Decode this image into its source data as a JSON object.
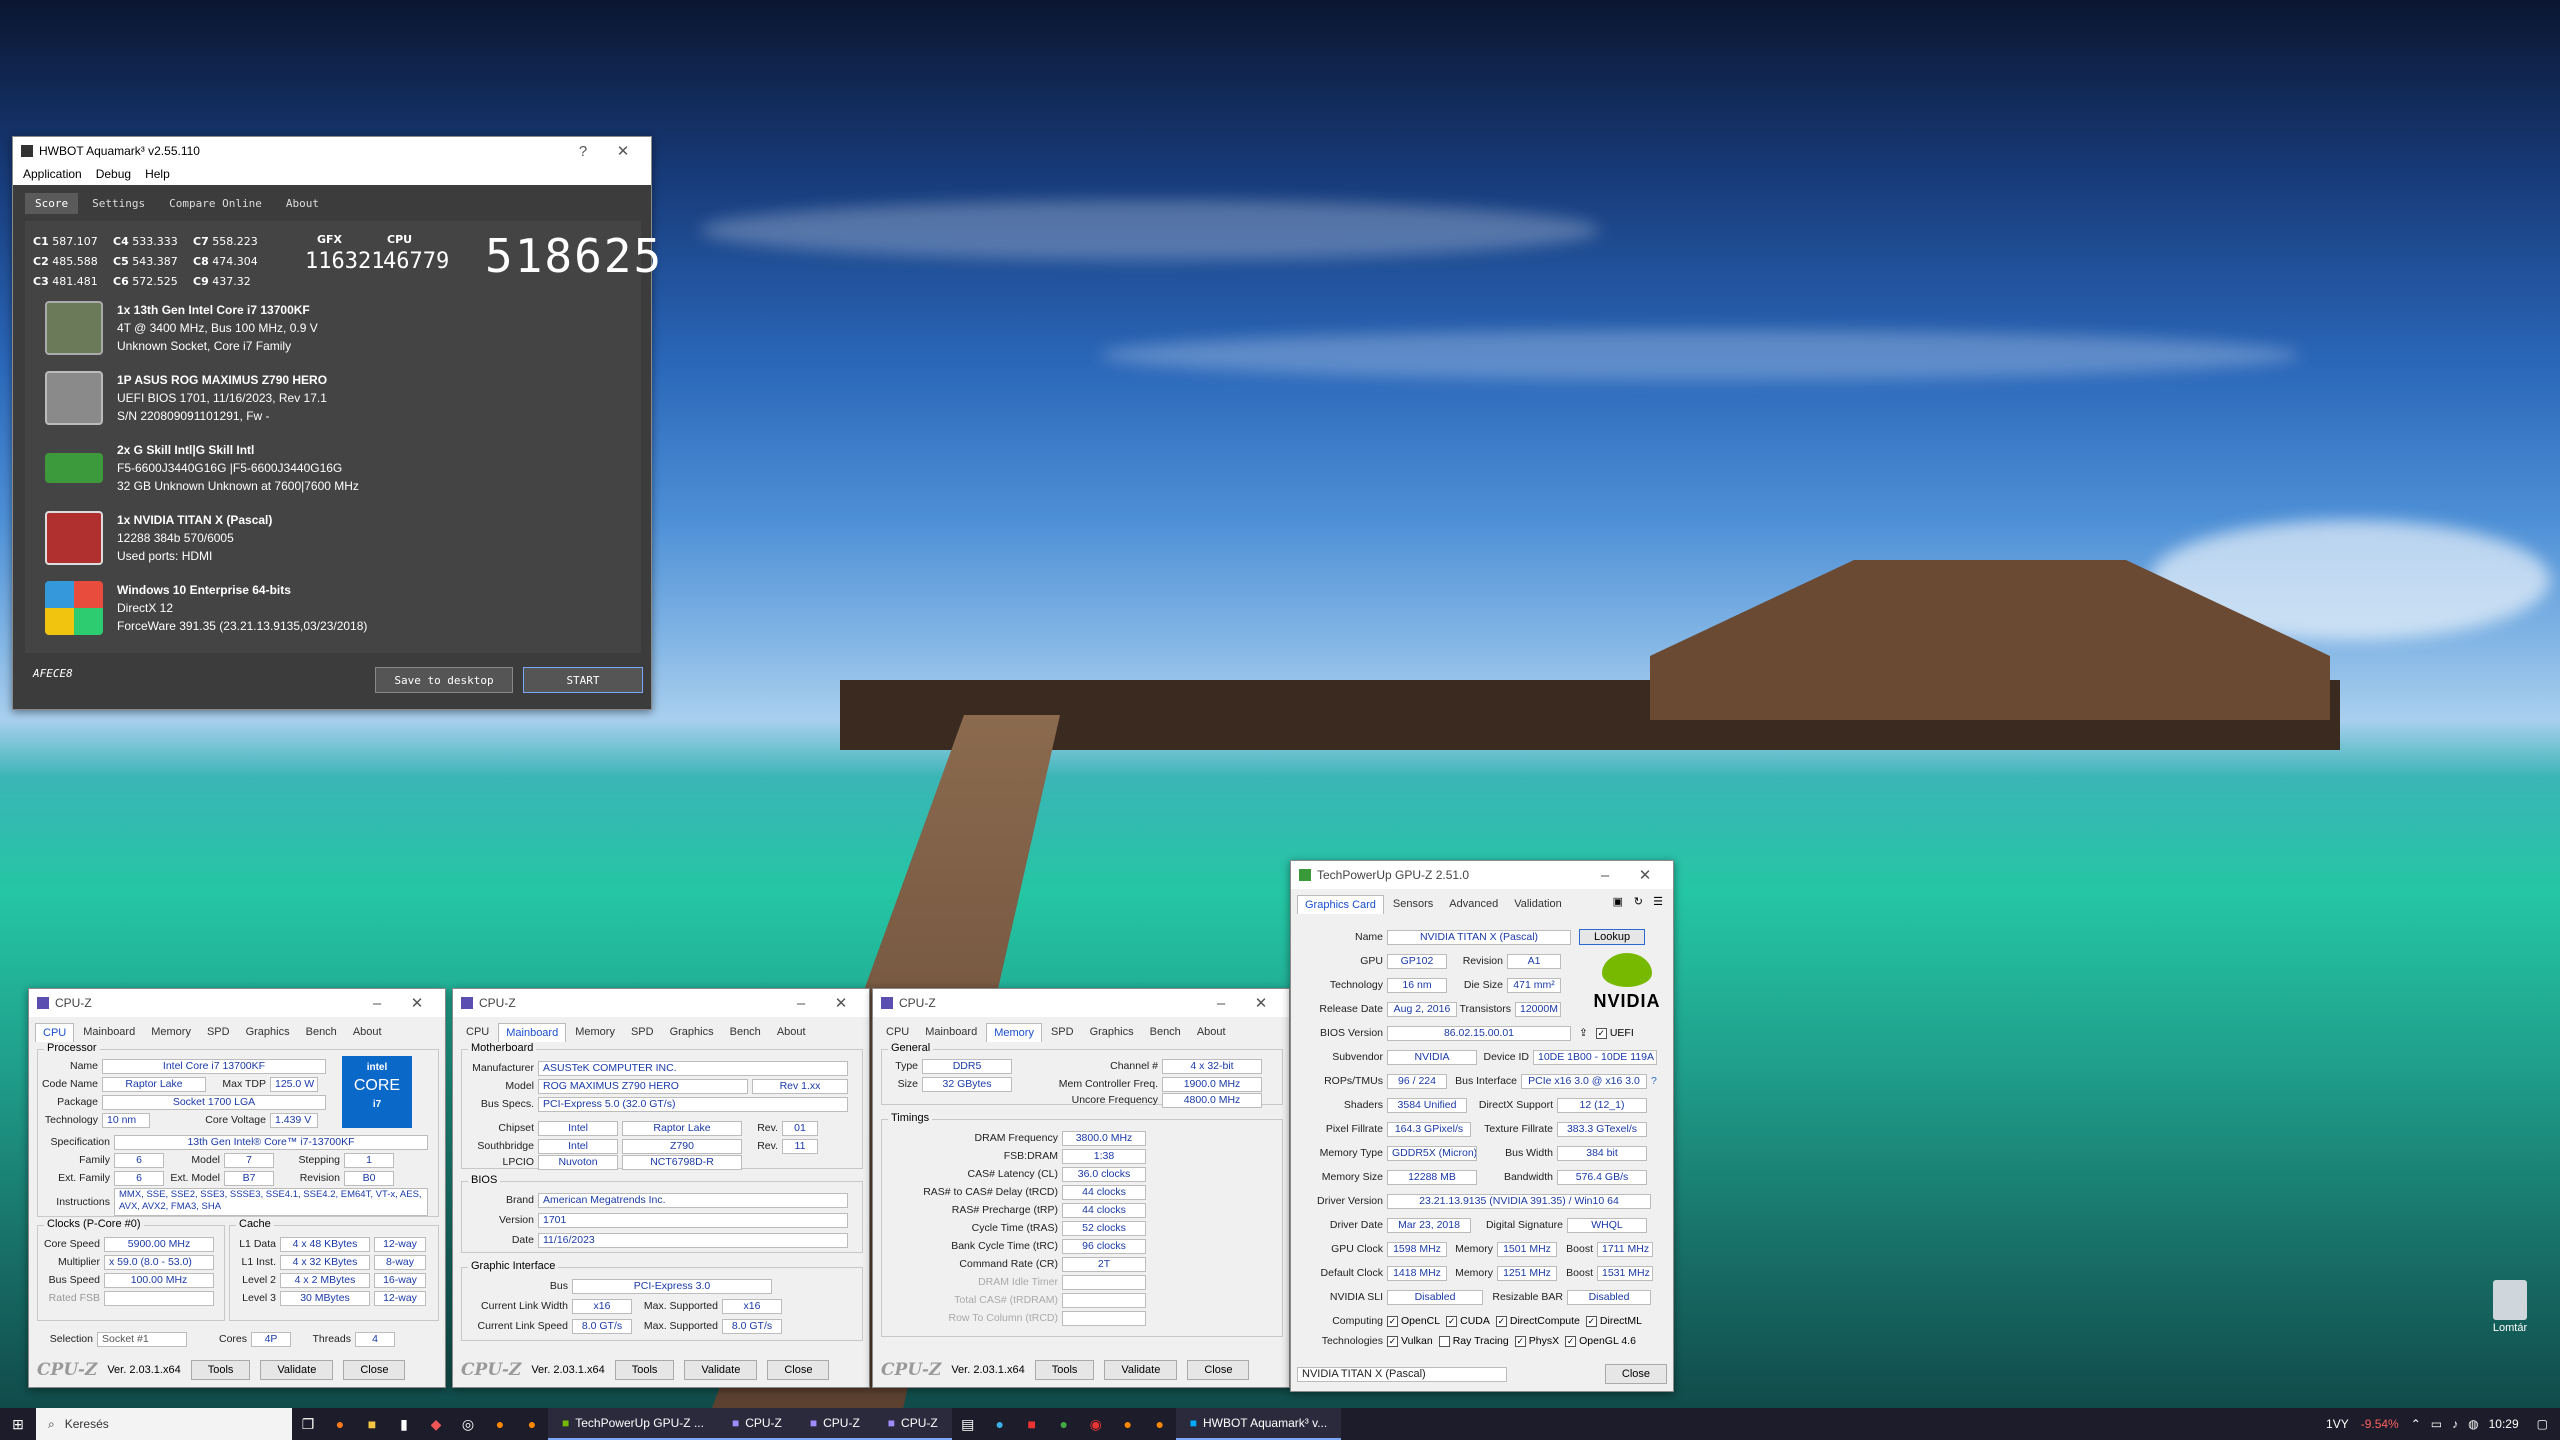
{
  "aquamark": {
    "title": "HWBOT Aquamark³ v2.55.110",
    "menu": [
      "Application",
      "Debug",
      "Help"
    ],
    "tabs": [
      "Score",
      "Settings",
      "Compare Online",
      "About"
    ],
    "c_scores": [
      [
        "C1",
        "587.107"
      ],
      [
        "C2",
        "485.588"
      ],
      [
        "C3",
        "481.481"
      ],
      [
        "C4",
        "533.333"
      ],
      [
        "C5",
        "543.387"
      ],
      [
        "C6",
        "572.525"
      ],
      [
        "C7",
        "558.223"
      ],
      [
        "C8",
        "474.304"
      ],
      [
        "C9",
        "437.32"
      ]
    ],
    "gfx_label": "GFX",
    "gfx": "116321",
    "cpu_label": "CPU",
    "cpu": "46779",
    "total": "518625",
    "hw": [
      {
        "title": "1x 13th Gen Intel Core i7 13700KF",
        "l1": "4T @ 3400 MHz, Bus 100 MHz, 0.9 V",
        "l2": "Unknown Socket, Core i7 Family"
      },
      {
        "title": "1P ASUS ROG MAXIMUS Z790 HERO",
        "l1": "UEFI BIOS 1701, 11/16/2023, Rev 17.1",
        "l2": "S/N 220809091101291, Fw -"
      },
      {
        "title": "2x G Skill Intl|G Skill Intl",
        "l1": "F5-6600J3440G16G   |F5-6600J3440G16G",
        "l2": "32 GB Unknown Unknown at 7600|7600 MHz"
      },
      {
        "title": "1x NVIDIA TITAN X (Pascal)",
        "l1": "12288  384b 570/6005",
        "l2": "Used ports: HDMI"
      },
      {
        "title": "Windows 10 Enterprise 64-bits",
        "l1": "DirectX 12",
        "l2": "ForceWare 391.35 (23.21.13.9135,03/23/2018)"
      }
    ],
    "code": "AFECE8",
    "save_btn": "Save to desktop",
    "start_btn": "START"
  },
  "cpuz1": {
    "title": "CPU-Z",
    "tabs": [
      "CPU",
      "Mainboard",
      "Memory",
      "SPD",
      "Graphics",
      "Bench",
      "About"
    ],
    "proc_label": "Processor",
    "name_l": "Name",
    "name": "Intel Core i7 13700KF",
    "code_l": "Code Name",
    "code": "Raptor Lake",
    "tdp_l": "Max TDP",
    "tdp": "125.0 W",
    "pkg_l": "Package",
    "pkg": "Socket 1700 LGA",
    "tech_l": "Technology",
    "tech": "10 nm",
    "cv_l": "Core Voltage",
    "cv": "1.439 V",
    "spec_l": "Specification",
    "spec": "13th Gen Intel® Core™ i7-13700KF",
    "fam_l": "Family",
    "fam": "6",
    "mod_l": "Model",
    "mod": "7",
    "step_l": "Stepping",
    "step": "1",
    "efam_l": "Ext. Family",
    "efam": "6",
    "emod_l": "Ext. Model",
    "emod": "B7",
    "rev_l": "Revision",
    "rev": "B0",
    "ins_l": "Instructions",
    "ins": "MMX, SSE, SSE2, SSE3, SSSE3, SSE4.1, SSE4.2, EM64T, VT-x, AES, AVX, AVX2, FMA3, SHA",
    "clk_label": "Clocks (P-Core #0)",
    "cs_l": "Core Speed",
    "cs": "5900.00 MHz",
    "mul_l": "Multiplier",
    "mul": "x 59.0 (8.0 - 53.0)",
    "bus_l": "Bus Speed",
    "bus": "100.00 MHz",
    "fsb_l": "Rated FSB",
    "cache_label": "Cache",
    "l1d_l": "L1 Data",
    "l1d": "4 x 48 KBytes",
    "l1d_w": "12-way",
    "l1i_l": "L1 Inst.",
    "l1i": "4 x 32 KBytes",
    "l1i_w": "8-way",
    "l2_l": "Level 2",
    "l2": "4 x 2 MBytes",
    "l2_w": "16-way",
    "l3_l": "Level 3",
    "l3": "30 MBytes",
    "l3_w": "12-way",
    "sel_l": "Selection",
    "sel": "Socket #1",
    "cores_l": "Cores",
    "cores": "4P",
    "thr_l": "Threads",
    "thr": "4",
    "intel": "intel",
    "core": "CORE",
    "i7": "i7",
    "logo": "CPU-Z",
    "ver": "Ver. 2.03.1.x64",
    "tools": "Tools",
    "validate": "Validate",
    "close": "Close"
  },
  "cpuz2": {
    "title": "CPU-Z",
    "mb_label": "Motherboard",
    "man_l": "Manufacturer",
    "man": "ASUSTeK COMPUTER INC.",
    "model_l": "Model",
    "model": "ROG MAXIMUS Z790 HERO",
    "model_rev": "Rev 1.xx",
    "bus_l": "Bus Specs.",
    "bus": "PCI-Express 5.0 (32.0 GT/s)",
    "chip_l": "Chipset",
    "chip_v": "Intel",
    "chip_n": "Raptor Lake",
    "rev_l": "Rev.",
    "chip_r": "01",
    "sb_l": "Southbridge",
    "sb_v": "Intel",
    "sb_n": "Z790",
    "sb_r": "11",
    "lpc_l": "LPCIO",
    "lpc_v": "Nuvoton",
    "lpc_n": "NCT6798D-R",
    "bios_label": "BIOS",
    "brand_l": "Brand",
    "brand": "American Megatrends Inc.",
    "ver_l": "Version",
    "ver": "1701",
    "date_l": "Date",
    "date": "11/16/2023",
    "gi_label": "Graphic Interface",
    "gbus_l": "Bus",
    "gbus": "PCI-Express 3.0",
    "clw_l": "Current Link Width",
    "clw": "x16",
    "msw_l": "Max. Supported",
    "msw": "x16",
    "cls_l": "Current Link Speed",
    "cls": "8.0 GT/s",
    "mss_l": "Max. Supported",
    "mss": "8.0 GT/s"
  },
  "cpuz3": {
    "title": "CPU-Z",
    "gen_label": "General",
    "type_l": "Type",
    "type": "DDR5",
    "ch_l": "Channel #",
    "ch": "4 x 32-bit",
    "size_l": "Size",
    "size": "32 GBytes",
    "mcf_l": "Mem Controller Freq.",
    "mcf": "1900.0 MHz",
    "uf_l": "Uncore Frequency",
    "uf": "4800.0 MHz",
    "tim_label": "Timings",
    "timings": [
      [
        "DRAM Frequency",
        "3800.0 MHz"
      ],
      [
        "FSB:DRAM",
        "1:38"
      ],
      [
        "CAS# Latency (CL)",
        "36.0 clocks"
      ],
      [
        "RAS# to CAS# Delay (tRCD)",
        "44 clocks"
      ],
      [
        "RAS# Precharge (tRP)",
        "44 clocks"
      ],
      [
        "Cycle Time (tRAS)",
        "52 clocks"
      ],
      [
        "Bank Cycle Time (tRC)",
        "96 clocks"
      ],
      [
        "Command Rate (CR)",
        "2T"
      ],
      [
        "DRAM Idle Timer",
        ""
      ],
      [
        "Total CAS# (tRDRAM)",
        ""
      ],
      [
        "Row To Column (tRCD)",
        ""
      ]
    ]
  },
  "gpuz": {
    "title": "TechPowerUp GPU-Z 2.51.0",
    "tabs": [
      "Graphics Card",
      "Sensors",
      "Advanced",
      "Validation"
    ],
    "lookup": "Lookup",
    "nvidia": "NVIDIA",
    "rows": [
      [
        "Name",
        "NVIDIA TITAN X (Pascal)",
        "",
        ""
      ],
      [
        "GPU",
        "GP102",
        "Revision",
        "A1"
      ],
      [
        "Technology",
        "16 nm",
        "Die Size",
        "471 mm²"
      ],
      [
        "Release Date",
        "Aug 2, 2016",
        "Transistors",
        "12000M"
      ],
      [
        "BIOS Version",
        "86.02.15.00.01",
        "",
        ""
      ],
      [
        "Subvendor",
        "NVIDIA",
        "Device ID",
        "10DE 1B00 - 10DE 119A"
      ],
      [
        "ROPs/TMUs",
        "96 / 224",
        "Bus Interface",
        "PCIe x16 3.0 @ x16 3.0"
      ],
      [
        "Shaders",
        "3584 Unified",
        "DirectX Support",
        "12 (12_1)"
      ],
      [
        "Pixel Fillrate",
        "164.3 GPixel/s",
        "Texture Fillrate",
        "383.3 GTexel/s"
      ],
      [
        "Memory Type",
        "GDDR5X (Micron)",
        "Bus Width",
        "384 bit"
      ],
      [
        "Memory Size",
        "12288 MB",
        "Bandwidth",
        "576.4 GB/s"
      ],
      [
        "Driver Version",
        "23.21.13.9135 (NVIDIA 391.35) / Win10 64",
        "",
        ""
      ],
      [
        "Driver Date",
        "Mar 23, 2018",
        "Digital Signature",
        "WHQL"
      ]
    ],
    "uefi": "UEFI",
    "gclk_l": "GPU Clock",
    "gclk": "1598 MHz",
    "mem_l": "Memory",
    "gmem": "1501 MHz",
    "boost_l": "Boost",
    "gboost": "1711 MHz",
    "dclk_l": "Default Clock",
    "dclk": "1418 MHz",
    "dmem": "1251 MHz",
    "dboost": "1531 MHz",
    "sli_l": "NVIDIA SLI",
    "sli": "Disabled",
    "rbar_l": "Resizable BAR",
    "rbar": "Disabled",
    "comp_l": "Computing",
    "comp": [
      "OpenCL",
      "CUDA",
      "DirectCompute",
      "DirectML"
    ],
    "tech_l": "Technologies",
    "techs": [
      "Vulkan",
      "Ray Tracing",
      "PhysX",
      "OpenGL 4.6"
    ],
    "select": "NVIDIA TITAN X (Pascal)",
    "close": "Close"
  },
  "taskbar": {
    "search": "Keresés",
    "apps": [
      "TechPowerUp GPU-Z ...",
      "CPU-Z",
      "CPU-Z",
      "CPU-Z",
      "HWBOT Aquamark³ v..."
    ],
    "lang": "1VY",
    "cpu": "-9.54%",
    "time": "10:29"
  },
  "desktop": {
    "recycle": "Lomtár"
  }
}
